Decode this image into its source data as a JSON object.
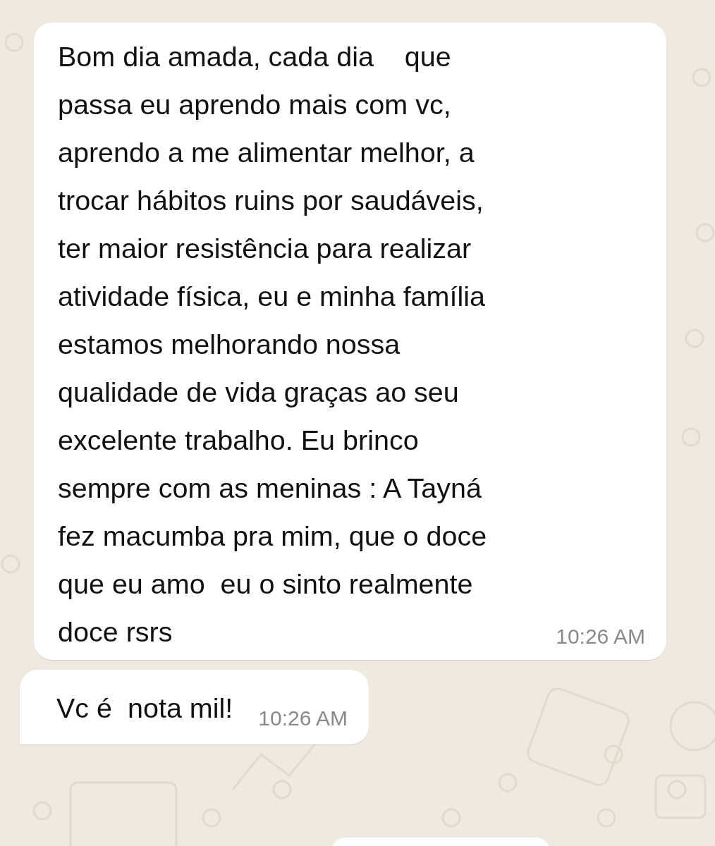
{
  "messages": [
    {
      "text": "Bom dia amada, cada dia    que\npassa eu aprendo mais com vc,\naprendo a me alimentar melhor, a\ntrocar hábitos ruins por saudáveis,\nter maior resistência para realizar\natividade física, eu e minha família\nestamos melhorando nossa\nqualidade de vida graças ao seu\nexcelente trabalho. Eu brinco\nsempre com as meninas : A Tayná\nfez macumba pra mim, que o doce\nque eu amo  eu o sinto realmente\ndoce rsrs",
      "time": "10:26 AM",
      "tail": false
    },
    {
      "text": "Vc é  nota mil!",
      "time": "10:26 AM",
      "tail": true
    }
  ]
}
